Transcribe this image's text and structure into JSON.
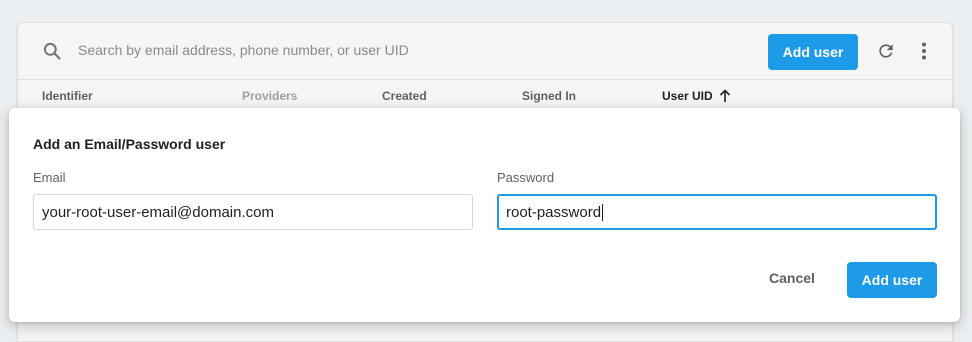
{
  "toolbar": {
    "search_placeholder": "Search by email address, phone number, or user UID",
    "add_user_label": "Add user",
    "icons": [
      "search-icon",
      "refresh-icon",
      "more-vert-icon"
    ]
  },
  "table": {
    "columns": [
      {
        "label": "Identifier",
        "state": "normal"
      },
      {
        "label": "Providers",
        "state": "disabled"
      },
      {
        "label": "Created",
        "state": "normal"
      },
      {
        "label": "Signed In",
        "state": "normal"
      },
      {
        "label": "User UID",
        "state": "sorted-ascending"
      }
    ]
  },
  "dialog": {
    "title": "Add an Email/Password user",
    "email_label": "Email",
    "email_value": "your-root-user-email@domain.com",
    "password_label": "Password",
    "password_value": "root-password",
    "cancel_label": "Cancel",
    "submit_label": "Add user"
  },
  "colors": {
    "primary": "#1e9be8",
    "background": "#eceff1"
  }
}
